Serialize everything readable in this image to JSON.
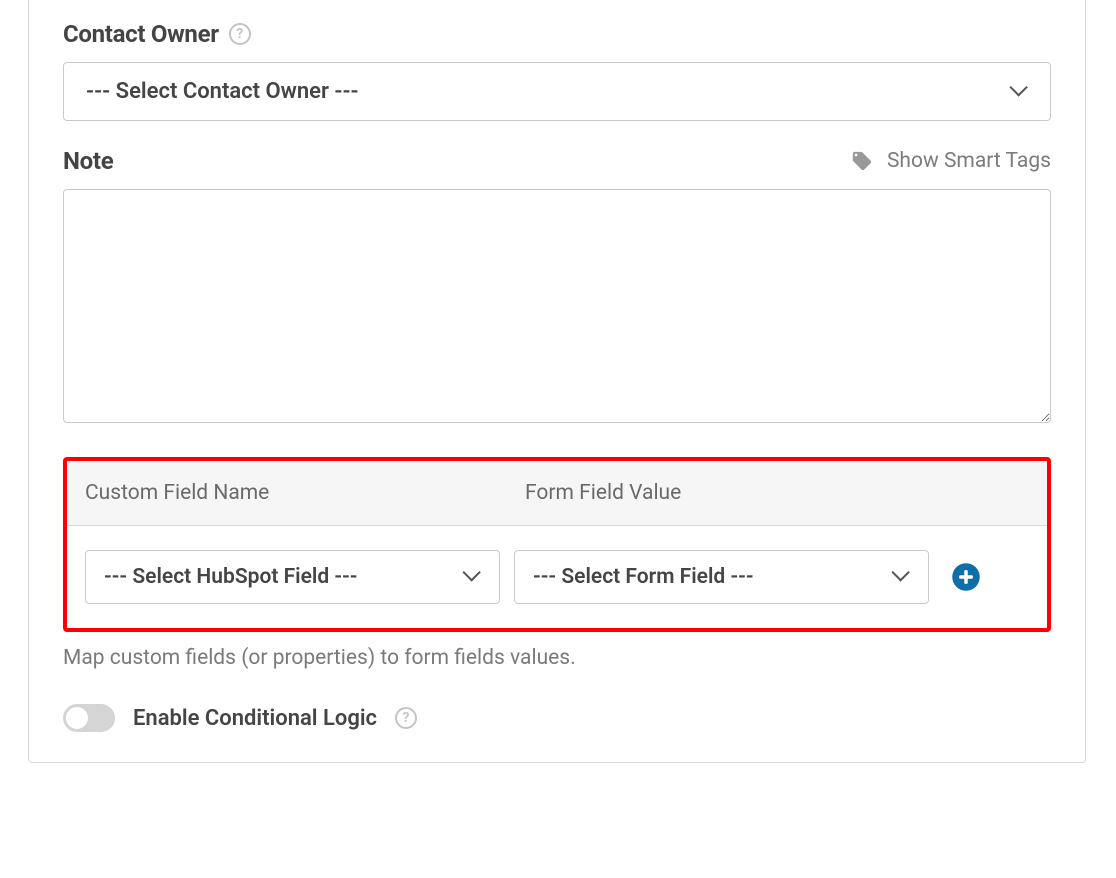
{
  "contactOwner": {
    "label": "Contact Owner",
    "selectedText": "--- Select Contact Owner ---"
  },
  "note": {
    "label": "Note",
    "smartTagsLabel": "Show Smart Tags",
    "value": ""
  },
  "customMapping": {
    "columns": {
      "fieldName": "Custom Field Name",
      "fieldValue": "Form Field Value"
    },
    "row": {
      "hubspotFieldText": "--- Select HubSpot Field ---",
      "formFieldText": "--- Select Form Field ---"
    },
    "helperText": "Map custom fields (or properties) to form fields values."
  },
  "conditionalLogic": {
    "label": "Enable Conditional Logic",
    "enabled": false
  }
}
